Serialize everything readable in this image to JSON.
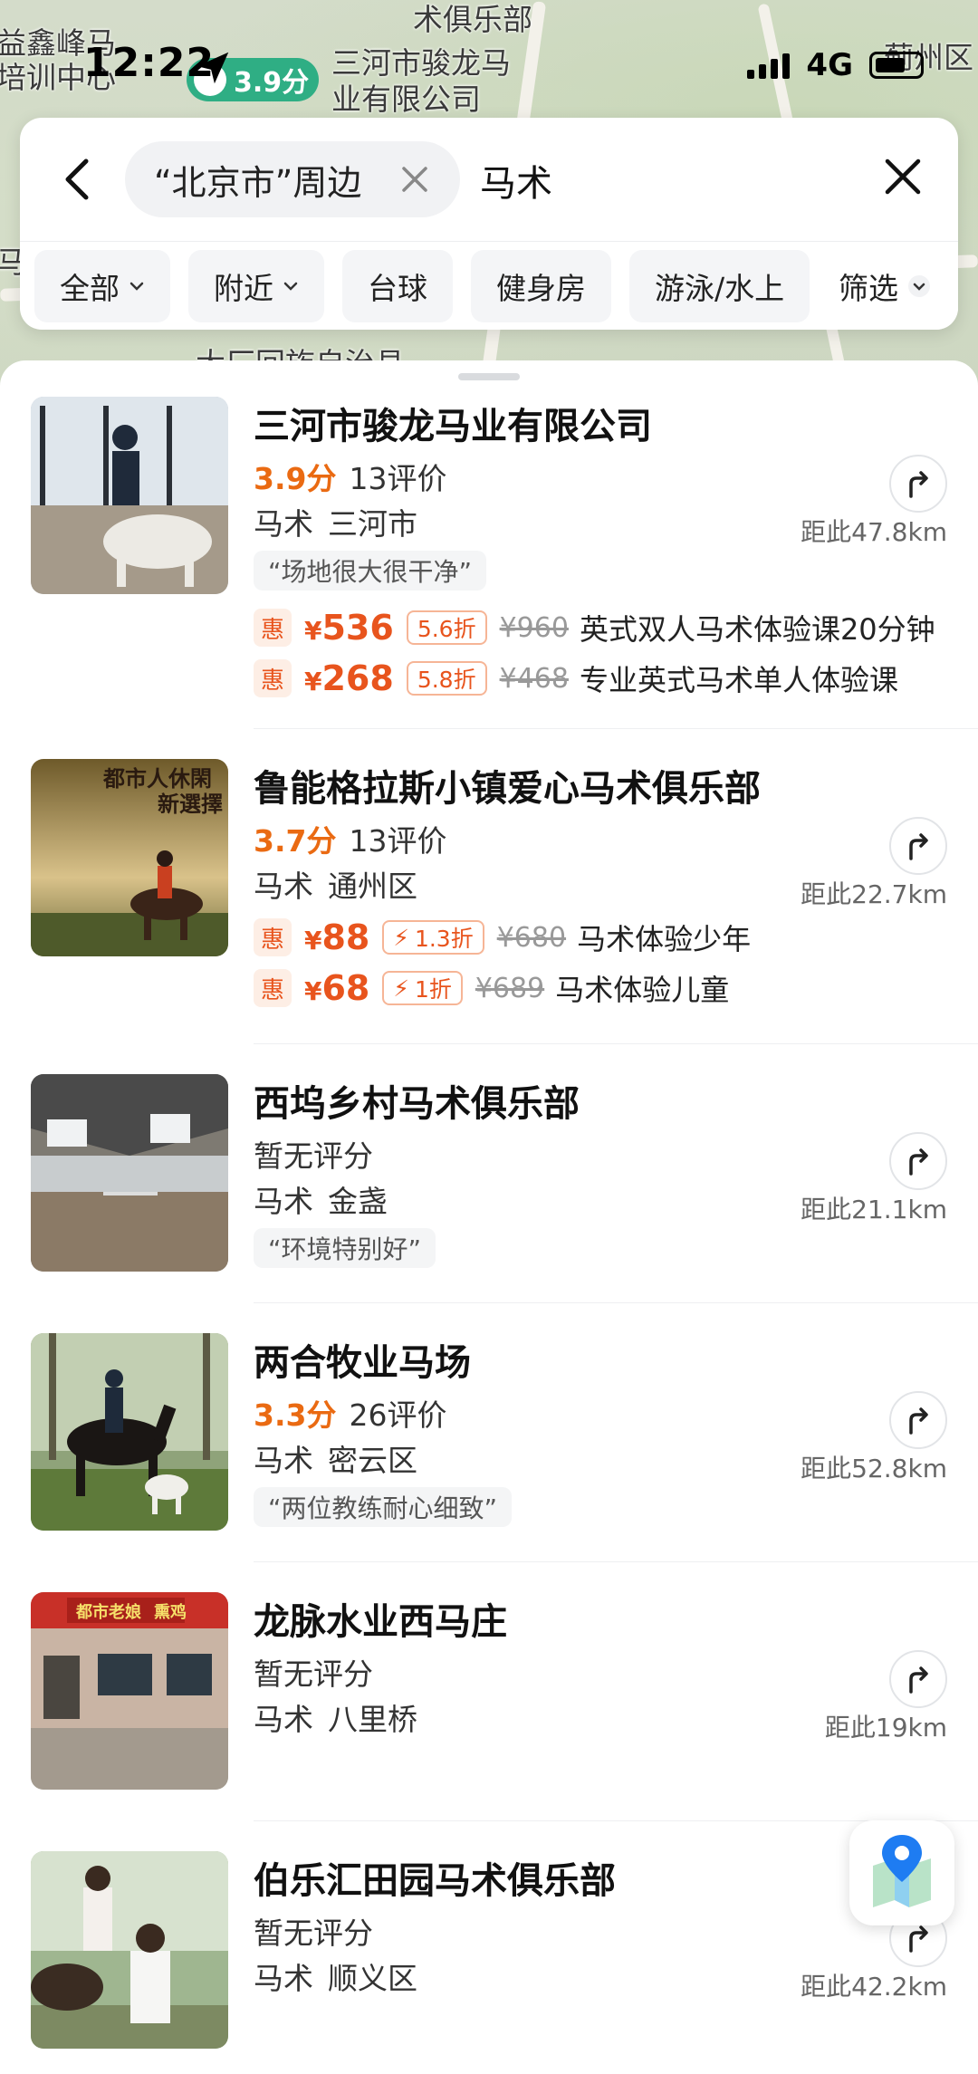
{
  "map": {
    "labels": [
      "益鑫峰马",
      "培训中心",
      "术俱乐部",
      "三河市骏龙马",
      "业有限公司",
      "蓟州区",
      "马",
      "大厂回族自治县"
    ],
    "rating_pill": "3.9分"
  },
  "status_bar": {
    "time": "12:22",
    "network": "4G"
  },
  "search": {
    "region": "“北京市”周边",
    "query": "马术"
  },
  "filters": [
    {
      "label": "全部",
      "dropdown": true
    },
    {
      "label": "附近",
      "dropdown": true
    },
    {
      "label": "台球",
      "dropdown": false
    },
    {
      "label": "健身房",
      "dropdown": false
    },
    {
      "label": "游泳/水上",
      "dropdown": false
    }
  ],
  "filter_more": "筛选",
  "results": [
    {
      "name": "三河市骏龙马业有限公司",
      "score": "3.9分",
      "reviews": "13评价",
      "category": "马术",
      "area": "三河市",
      "distance": "距此47.8km",
      "quote": "“场地很大很干净”",
      "deals": [
        {
          "tag": "惠",
          "yen": "¥",
          "price": "536",
          "discount": "5.6折",
          "original": "¥960",
          "name": "英式双人马术体验课20分钟"
        },
        {
          "tag": "惠",
          "yen": "¥",
          "price": "268",
          "discount": "5.8折",
          "original": "¥468",
          "name": "专业英式马术单人体验课"
        }
      ]
    },
    {
      "name": "鲁能格拉斯小镇爱心马术俱乐部",
      "score": "3.7分",
      "reviews": "13评价",
      "category": "马术",
      "area": "通州区",
      "distance": "距此22.7km",
      "thumb_text": [
        "都市人休閑",
        "新選擇"
      ],
      "deals": [
        {
          "tag": "惠",
          "yen": "¥",
          "price": "88",
          "discount": "1.3折",
          "original": "¥680",
          "name": "马术体验少年"
        },
        {
          "tag": "惠",
          "yen": "¥",
          "price": "68",
          "discount": "1折",
          "original": "¥689",
          "name": "马术体验儿童"
        }
      ]
    },
    {
      "name": "西坞乡村马术俱乐部",
      "score_text": "暂无评分",
      "category": "马术",
      "area": "金盏",
      "distance": "距此21.1km",
      "quote": "“环境特别好”"
    },
    {
      "name": "两合牧业马场",
      "score": "3.3分",
      "reviews": "26评价",
      "category": "马术",
      "area": "密云区",
      "distance": "距此52.8km",
      "quote": "“两位教练耐心细致”"
    },
    {
      "name": "龙脉水业西马庄",
      "score_text": "暂无评分",
      "category": "马术",
      "area": "八里桥",
      "distance": "距此19km",
      "thumb_text": [
        "都市老娘",
        "熏鸡"
      ]
    },
    {
      "name": "伯乐汇田园马术俱乐部",
      "score_text": "暂无评分",
      "category": "马术",
      "area": "顺义区",
      "distance": "距此42.2km"
    }
  ]
}
